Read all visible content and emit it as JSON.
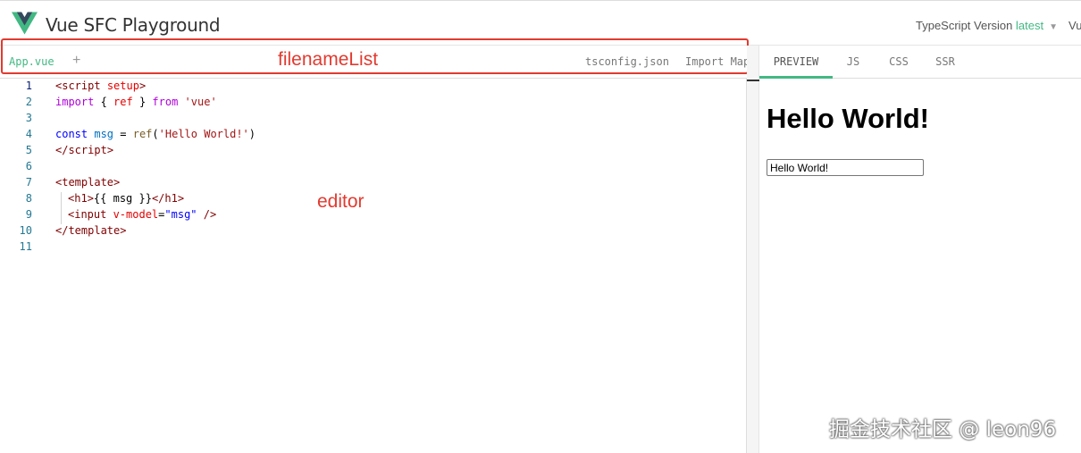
{
  "header": {
    "title": "Vue SFC Playground",
    "ts_label": "TypeScript Version",
    "ts_value": "latest",
    "vue_label": "Vu",
    "logo_colors": {
      "outer": "#42b883",
      "inner": "#35495e"
    }
  },
  "files": {
    "tabs": [
      {
        "label": "App.vue",
        "active": true
      },
      {
        "label": "tsconfig.json",
        "active": false
      },
      {
        "label": "Import Map",
        "active": false
      }
    ],
    "add_label": "+"
  },
  "annotations": {
    "filename_list": "filenameList",
    "editor": "editor"
  },
  "editor": {
    "lines": [
      {
        "n": "1"
      },
      {
        "n": "2"
      },
      {
        "n": "3"
      },
      {
        "n": "4"
      },
      {
        "n": "5"
      },
      {
        "n": "6"
      },
      {
        "n": "7"
      },
      {
        "n": "8"
      },
      {
        "n": "9"
      },
      {
        "n": "10"
      },
      {
        "n": "11"
      }
    ],
    "code": {
      "l1_open": "<",
      "l1_tag": "script",
      "l1_attr": " setup",
      "l1_close": ">",
      "l2_import": "import",
      "l2_brace_open": " { ",
      "l2_ref": "ref",
      "l2_brace_close": " } ",
      "l2_from": "from",
      "l2_str": " 'vue'",
      "l4_const": "const",
      "l4_var": " msg",
      "l4_eq": " = ",
      "l4_fn": "ref",
      "l4_paren_open": "(",
      "l4_str": "'Hello World!'",
      "l4_paren_close": ")",
      "l5_open": "</",
      "l5_tag": "script",
      "l5_close": ">",
      "l7_open": "<",
      "l7_tag": "template",
      "l7_close": ">",
      "l8_open": "<",
      "l8_tag": "h1",
      "l8_close": ">",
      "l8_mus": "{{ msg }}",
      "l8_end_open": "</",
      "l8_end_tag": "h1",
      "l8_end_close": ">",
      "l9_open": "<",
      "l9_tag": "input",
      "l9_attr": " v-model",
      "l9_eq": "=",
      "l9_str": "\"msg\"",
      "l9_close": " />",
      "l10_open": "</",
      "l10_tag": "template",
      "l10_close": ">"
    }
  },
  "output": {
    "tabs": [
      {
        "label": "PREVIEW",
        "active": true
      },
      {
        "label": "JS",
        "active": false
      },
      {
        "label": "CSS",
        "active": false
      },
      {
        "label": "SSR",
        "active": false
      }
    ],
    "preview_heading": "Hello World!",
    "preview_input_value": "Hello World!"
  },
  "watermark": "掘金技术社区 @ leon96"
}
